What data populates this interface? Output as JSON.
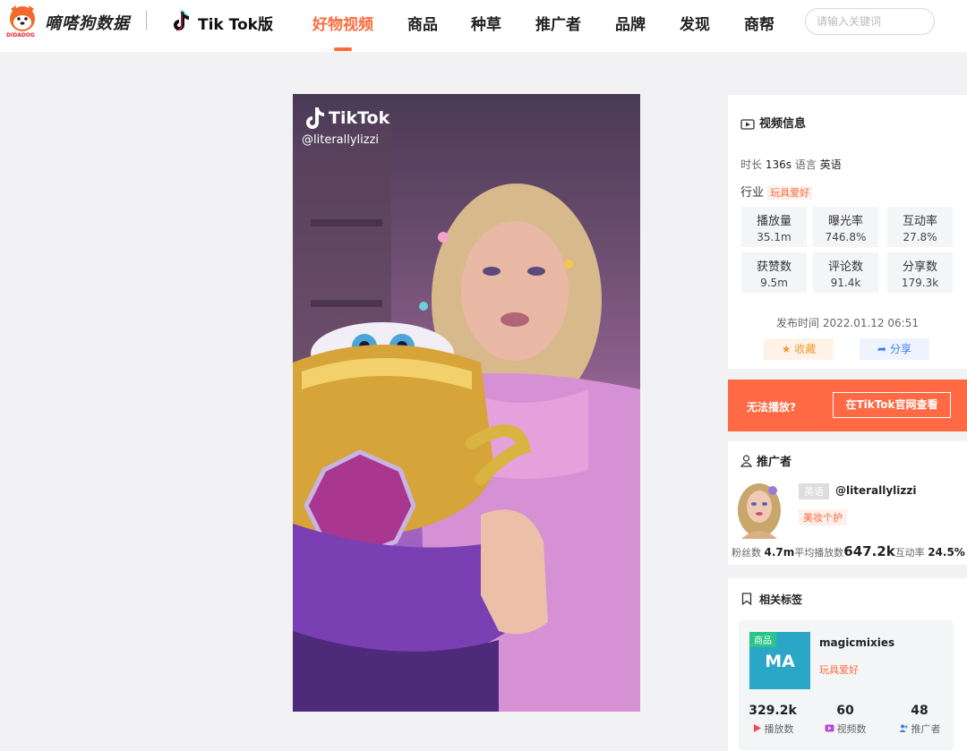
{
  "header": {
    "brand_name": "嘀嗒狗数据",
    "brand_sub": "DIDADOG",
    "tiktok_label": "Tik Tok版",
    "nav": [
      {
        "label": "好物视频",
        "active": true
      },
      {
        "label": "商品"
      },
      {
        "label": "种草"
      },
      {
        "label": "推广者"
      },
      {
        "label": "品牌"
      },
      {
        "label": "发现"
      },
      {
        "label": "商帮"
      }
    ],
    "search_placeholder": "请输入关键词"
  },
  "video": {
    "watermark_brand": "TikTok",
    "watermark_handle": "@literallylizzi"
  },
  "video_info": {
    "title": "视频信息",
    "duration_label": "时长",
    "duration": "136s",
    "language_label": "语言",
    "language": "英语",
    "industry_label": "行业",
    "industry": "玩具爱好",
    "stats": [
      {
        "label": "播放量",
        "value": "35.1m"
      },
      {
        "label": "曝光率",
        "value": "746.8%"
      },
      {
        "label": "互动率",
        "value": "27.8%"
      },
      {
        "label": "获赞数",
        "value": "9.5m"
      },
      {
        "label": "评论数",
        "value": "91.4k"
      },
      {
        "label": "分享数",
        "value": "179.3k"
      }
    ],
    "publish_label": "发布时间",
    "publish_time": "2022.01.12 06:51",
    "collect_label": "收藏",
    "share_label": "分享"
  },
  "cant_play": {
    "text": "无法播放?",
    "button": "在TikTok官网查看"
  },
  "promoter": {
    "title": "推广者",
    "language": "英语",
    "handle": "@literallylizzi",
    "category": "美妆个护",
    "followers_label": "粉丝数",
    "followers": "4.7m",
    "avg_play_label": "平均播放数",
    "avg_play": "647.2k",
    "engagement_label": "互动率",
    "engagement": "24.5%"
  },
  "tags": {
    "title": "相关标签",
    "badge": "商品",
    "abbr": "MA",
    "name": "magicmixies",
    "category": "玩具爱好",
    "stats": [
      {
        "value": "329.2k",
        "label": "播放数"
      },
      {
        "value": "60",
        "label": "视频数"
      },
      {
        "value": "48",
        "label": "推广者"
      }
    ]
  },
  "colors": {
    "accent": "#ff6a3c",
    "orange_bar": "#ff6a45",
    "brand_logo_bg": "#2aa6c6"
  }
}
